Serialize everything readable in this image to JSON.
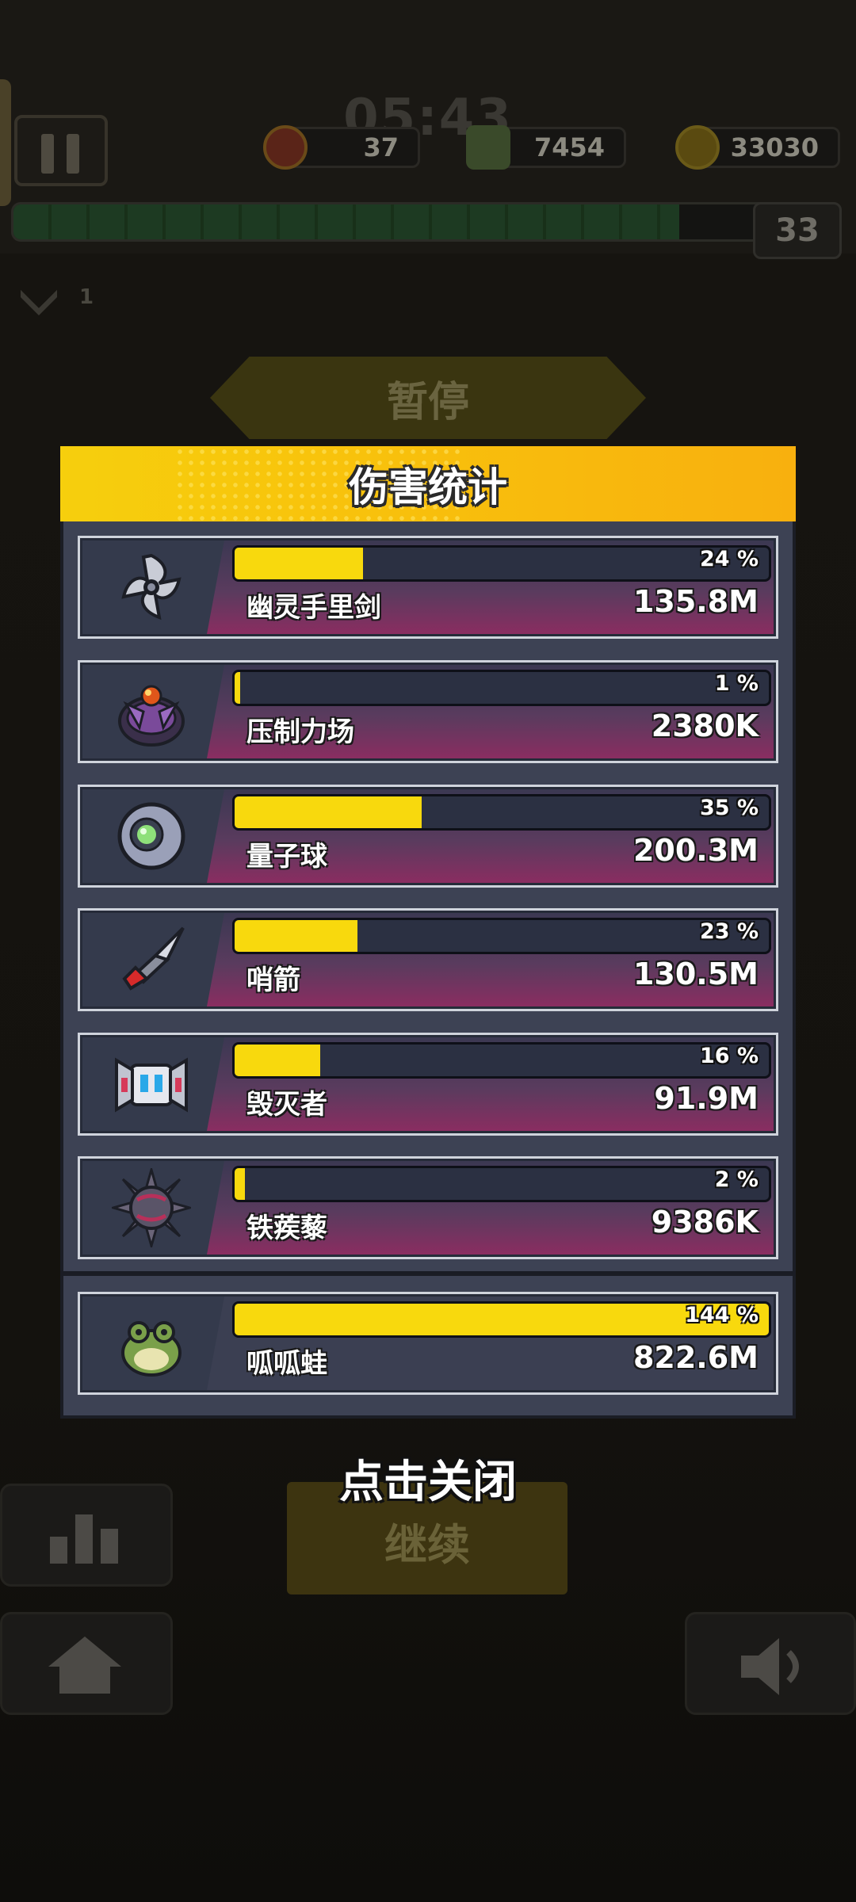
{
  "hud": {
    "timer": "05:43",
    "hearts": "37",
    "kills": "7454",
    "coins": "33030",
    "coins_small": "33030",
    "level": "33",
    "side_count": "1"
  },
  "pause_title": "暂停",
  "modal": {
    "title": "伤害统计",
    "colors": {
      "header": "#f8c20c",
      "bar_fill": "#f8d90d",
      "panel": "#3d4254"
    },
    "weapons": [
      {
        "name": "幽灵手里剑",
        "percent_label": "24 %",
        "percent": 24,
        "damage": "135.8M",
        "icon": "shuriken-icon"
      },
      {
        "name": "压制力场",
        "percent_label": "1 %",
        "percent": 1,
        "damage": "2380K",
        "icon": "force-field-icon"
      },
      {
        "name": "量子球",
        "percent_label": "35 %",
        "percent": 35,
        "damage": "200.3M",
        "icon": "quantum-orb-icon"
      },
      {
        "name": "哨箭",
        "percent_label": "23 %",
        "percent": 23,
        "damage": "130.5M",
        "icon": "sentry-arrow-icon"
      },
      {
        "name": "毁灭者",
        "percent_label": "16 %",
        "percent": 16,
        "damage": "91.9M",
        "icon": "destroyer-robot-icon"
      },
      {
        "name": "铁蒺藜",
        "percent_label": "2 %",
        "percent": 2,
        "damage": "9386K",
        "icon": "caltrop-icon"
      }
    ],
    "companion": {
      "name": "呱呱蛙",
      "percent_label": "144 %",
      "percent": 100,
      "damage": "822.6M",
      "icon": "frog-icon"
    }
  },
  "close_hint": "点击关闭",
  "continue_label": "继续"
}
